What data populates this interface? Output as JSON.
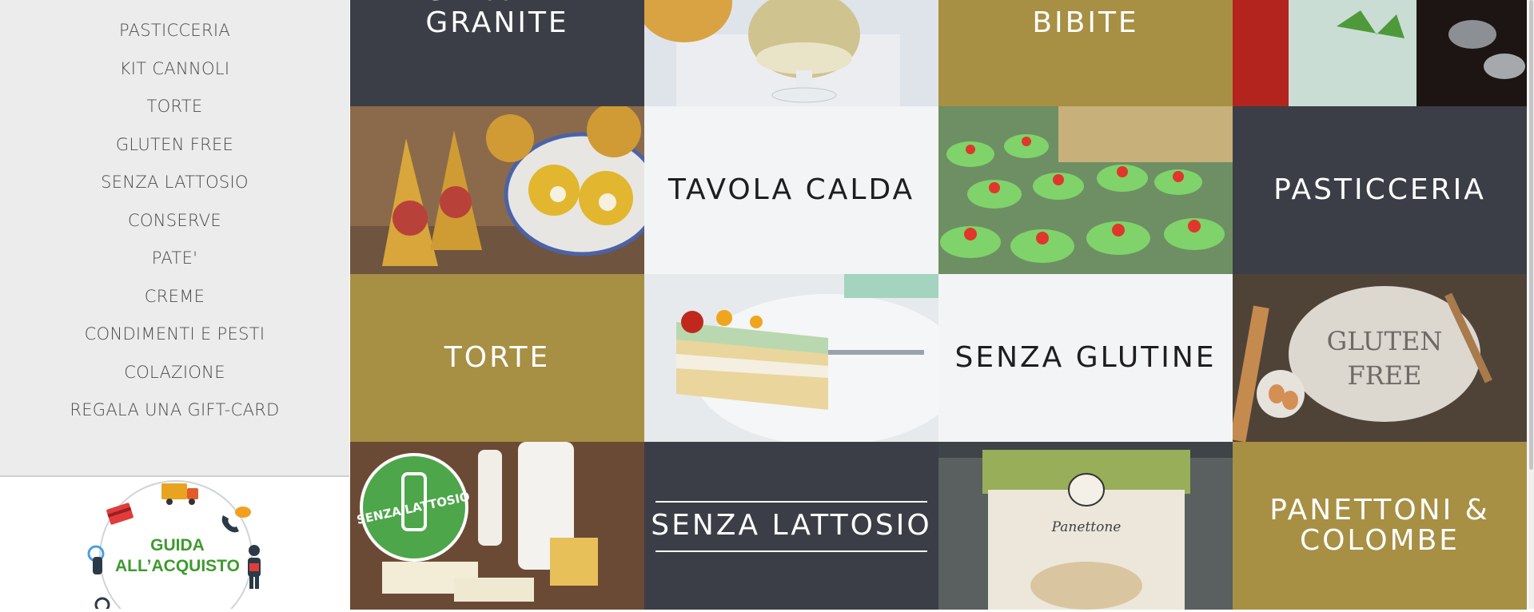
{
  "sidebar": {
    "items": [
      {
        "label": "PASTICCERIA"
      },
      {
        "label": "KIT CANNOLI"
      },
      {
        "label": "TORTE"
      },
      {
        "label": "GLUTEN FREE"
      },
      {
        "label": "SENZA LATTOSIO"
      },
      {
        "label": "CONSERVE"
      },
      {
        "label": "PATE'"
      },
      {
        "label": "CREME"
      },
      {
        "label": "CONDIMENTI E PESTI"
      },
      {
        "label": "COLAZIONE"
      },
      {
        "label": "REGALA UNA GIFT-CARD"
      }
    ],
    "guide": {
      "line1": "GUIDA",
      "line2": "ALL’ACQUISTO"
    }
  },
  "grid": {
    "gelati": "GELATI E GRANITE",
    "bibite": "BIBITE",
    "tavola_calda": "TAVOLA CALDA",
    "pasticceria": "PASTICCERIA",
    "torte": "TORTE",
    "senza_glutine": "SENZA GLUTINE",
    "senza_lattosio": "SENZA LATTOSIO",
    "panettoni_line1": "PANETTONI &",
    "panettoni_line2": "COLOMBE"
  },
  "images": {
    "gluten_free_text_1": "GLUTEN",
    "gluten_free_text_2": "FREE",
    "badge_text": "SENZA LATTOSIO",
    "panettone_label": "Panettone"
  },
  "colors": {
    "dark": "#3b3e46",
    "gold": "#a78f44",
    "light": "#f2f4f5",
    "sidebar_bg": "#ececec",
    "guide_green": "#3e9a2e"
  }
}
